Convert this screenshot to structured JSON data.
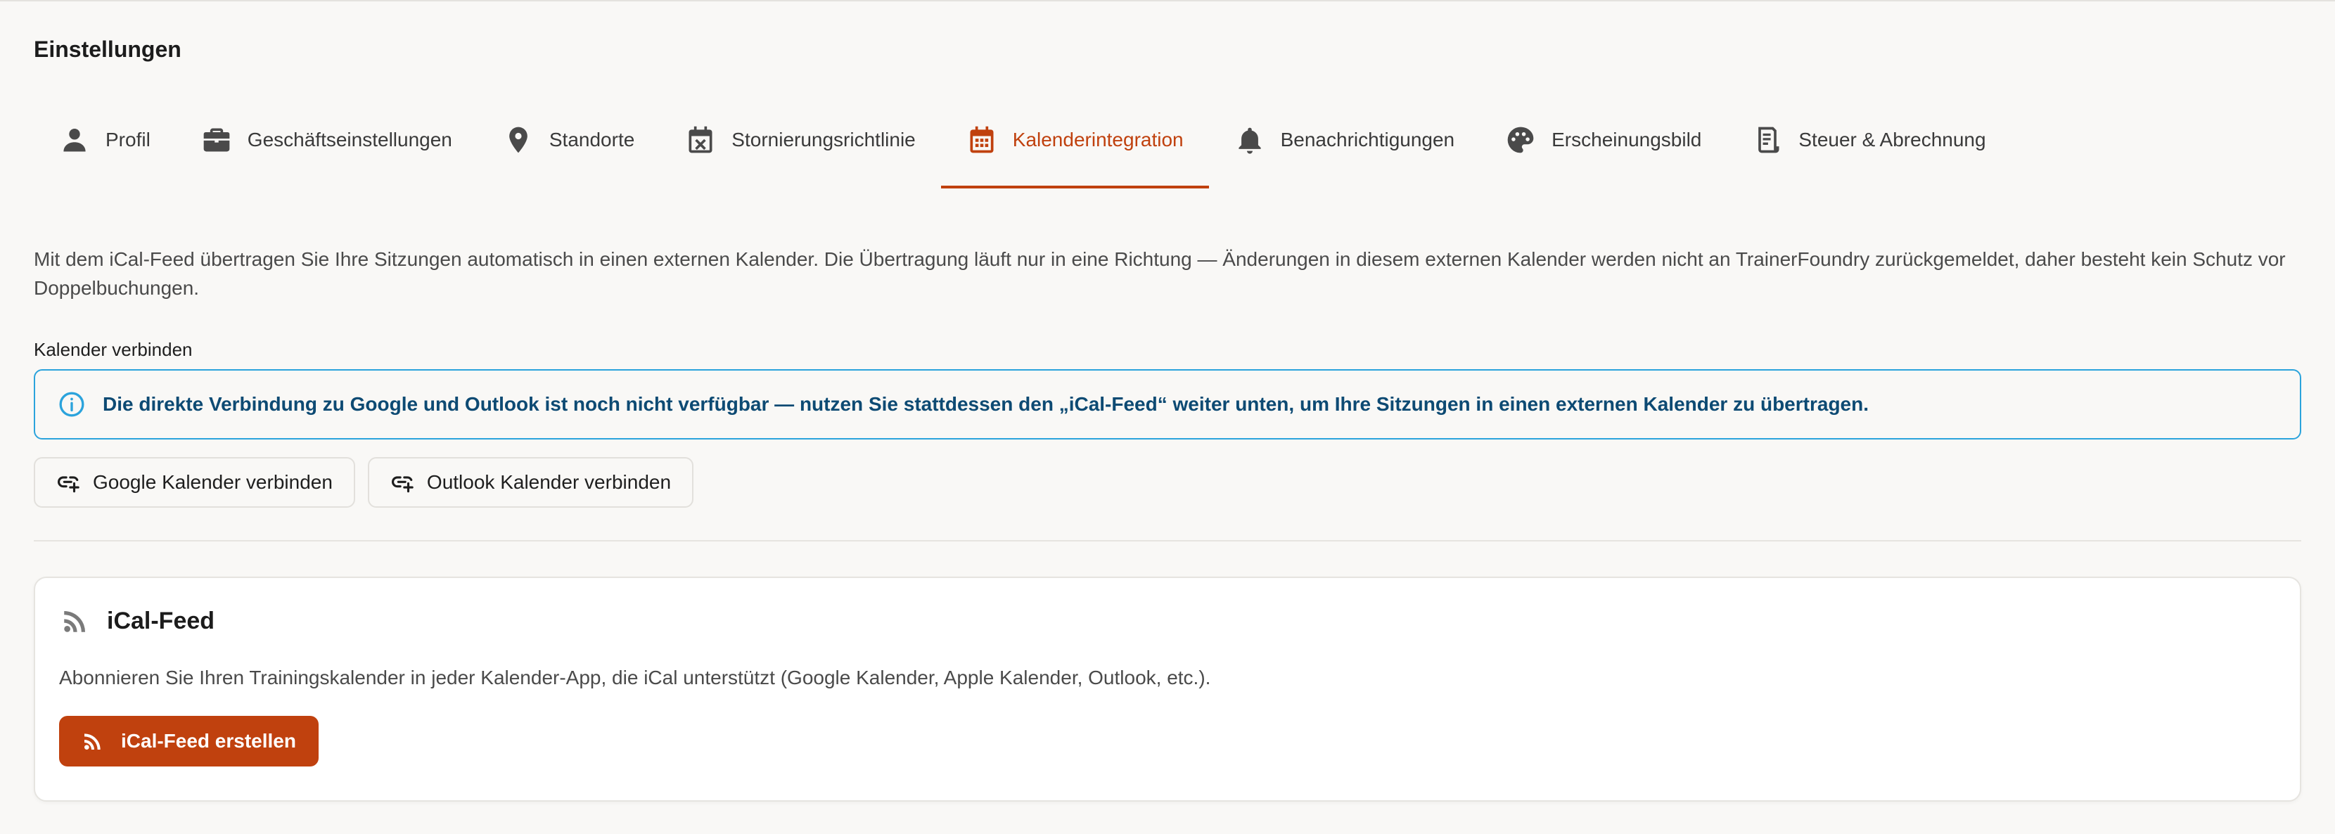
{
  "page": {
    "title": "Einstellungen"
  },
  "tabs": [
    {
      "label": "Profil",
      "icon": "person-icon",
      "active": false
    },
    {
      "label": "Geschäftseinstellungen",
      "icon": "briefcase-icon",
      "active": false
    },
    {
      "label": "Standorte",
      "icon": "location-pin-icon",
      "active": false
    },
    {
      "label": "Stornierungsrichtlinie",
      "icon": "calendar-x-icon",
      "active": false
    },
    {
      "label": "Kalenderintegration",
      "icon": "calendar-icon",
      "active": true
    },
    {
      "label": "Benachrichtigungen",
      "icon": "bell-icon",
      "active": false
    },
    {
      "label": "Erscheinungsbild",
      "icon": "palette-icon",
      "active": false
    },
    {
      "label": "Steuer & Abrechnung",
      "icon": "receipt-icon",
      "active": false
    }
  ],
  "intro": "Mit dem iCal-Feed übertragen Sie Ihre Sitzungen automatisch in einen externen Kalender. Die Übertragung läuft nur in eine Richtung — Änderungen in diesem externen Kalender werden nicht an TrainerFoundry zurückgemeldet, daher besteht kein Schutz vor Doppelbuchungen.",
  "connect": {
    "label": "Kalender verbinden",
    "alert": "Die direkte Verbindung zu Google und Outlook ist noch nicht verfügbar — nutzen Sie stattdessen den „iCal-Feed“ weiter unten, um Ihre Sitzungen in einen externen Kalender zu übertragen.",
    "google_button": "Google Kalender verbinden",
    "outlook_button": "Outlook Kalender verbinden"
  },
  "ical": {
    "title": "iCal-Feed",
    "description": "Abonnieren Sie Ihren Trainingskalender in jeder Kalender-App, die iCal unterstützt (Google Kalender, Apple Kalender, Outlook, etc.).",
    "create_button": "iCal-Feed erstellen"
  },
  "colors": {
    "accent": "#c0410e",
    "info_border": "#2ba3dc",
    "info_text": "#0d4a73",
    "background": "#f9f8f6"
  }
}
